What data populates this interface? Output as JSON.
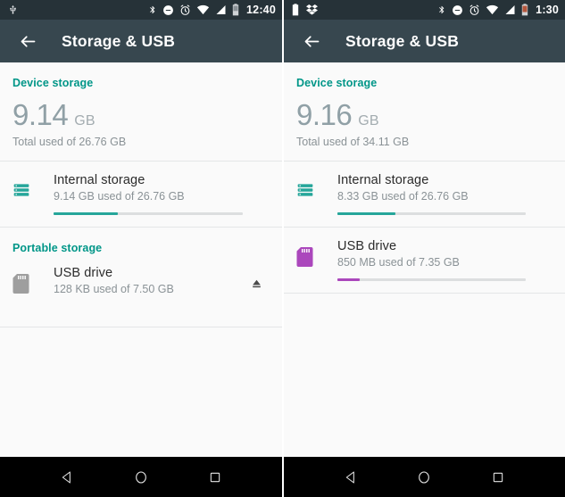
{
  "theme": {
    "statusbar_bg": "#263238",
    "appbar_bg": "#37474f",
    "content_bg": "#fafafa",
    "accent_teal": "#009688",
    "accent_purple": "#ab47bc",
    "navbar_bg": "#000000",
    "divider": "#e4e6e7"
  },
  "panels": [
    {
      "id": "left",
      "statusbar": {
        "left_icons": [
          "usb-icon"
        ],
        "right_icons": [
          "bluetooth-icon",
          "do-not-disturb-icon",
          "alarm-icon",
          "wifi-icon",
          "signal-icon",
          "battery-icon"
        ],
        "time": "12:40"
      },
      "appbar": {
        "back_label": "back-arrow",
        "title": "Storage & USB"
      },
      "device_section": {
        "header": "Device storage",
        "value": "9.14",
        "unit": "GB",
        "subtitle": "Total used of 26.76 GB"
      },
      "rows": [
        {
          "icon": "internal-storage-icon",
          "icon_color": "#26a69a",
          "title": "Internal storage",
          "subtitle": "9.14 GB used of 26.76 GB",
          "progress_percent": 34,
          "progress_color": "#26a69a",
          "has_progress": true,
          "action": ""
        }
      ],
      "portable_section": {
        "header": "Portable storage",
        "rows": [
          {
            "icon": "sd-card-icon",
            "icon_color": "#9e9e9e",
            "title": "USB drive",
            "subtitle": "128 KB used of 7.50 GB",
            "has_progress": false,
            "progress_percent": 0,
            "progress_color": "#9e9e9e",
            "action": "eject-icon"
          }
        ]
      },
      "navbar": {
        "back": "back-triangle-icon",
        "home": "home-circle-icon",
        "recents": "recents-square-icon"
      }
    },
    {
      "id": "right",
      "statusbar": {
        "left_icons": [
          "battery-status-icon",
          "dropbox-icon"
        ],
        "right_icons": [
          "bluetooth-icon",
          "do-not-disturb-icon",
          "alarm-icon",
          "wifi-icon",
          "signal-icon",
          "battery-icon"
        ],
        "time": "1:30"
      },
      "appbar": {
        "back_label": "back-arrow",
        "title": "Storage & USB"
      },
      "device_section": {
        "header": "Device storage",
        "value": "9.16",
        "unit": "GB",
        "subtitle": "Total used of 34.11 GB"
      },
      "rows": [
        {
          "icon": "internal-storage-icon",
          "icon_color": "#26a69a",
          "title": "Internal storage",
          "subtitle": "8.33 GB used of 26.76 GB",
          "progress_percent": 31,
          "progress_color": "#26a69a",
          "has_progress": true,
          "action": ""
        },
        {
          "icon": "sd-card-icon",
          "icon_color": "#ab47bc",
          "title": "USB drive",
          "subtitle": "850 MB used of 7.35 GB",
          "progress_percent": 12,
          "progress_color": "#ab47bc",
          "has_progress": true,
          "action": ""
        }
      ],
      "navbar": {
        "back": "back-triangle-icon",
        "home": "home-circle-icon",
        "recents": "recents-square-icon"
      }
    }
  ]
}
